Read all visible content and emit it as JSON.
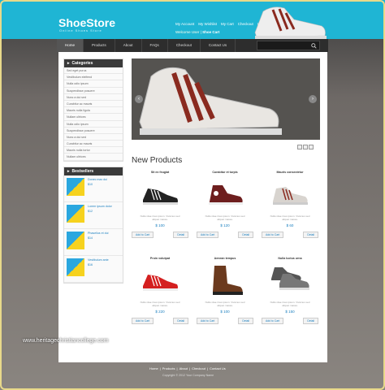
{
  "header": {
    "logo": "ShoeStore",
    "tagline": "Online Shoes Store",
    "links": [
      "My Account",
      "My Wishlist",
      "My Cart",
      "Checkout",
      "Log In"
    ],
    "welcome": "Welcome User",
    "cart": "Shoe Cart"
  },
  "nav": {
    "items": [
      "Home",
      "Products",
      "About",
      "FAQs",
      "Checkout",
      "Contact Us"
    ],
    "active": "Home"
  },
  "search": {
    "placeholder": ""
  },
  "sidebar": {
    "categories_title": "Categories",
    "categories": [
      "Sed eget purus",
      "Vestibulum eleifend",
      "Nulla odio ipsum",
      "Suspendisse posuere",
      "Nunc a dui sed",
      "Curabitur ac mauris",
      "Mauris nulla ligula",
      "Nullam ultrices",
      "Nulla odio ipsum",
      "Suspendisse posuere",
      "Nunc a dui sed",
      "Curabitur ac mauris",
      "Mauris nulla tortor",
      "Nullam ultrices"
    ],
    "bestsellers_title": "Bestsellers",
    "bestsellers": [
      {
        "name": "Donec max dui",
        "price": "$10"
      },
      {
        "name": "Lorem ipsum dolor",
        "price": "$12"
      },
      {
        "name": "Phasellus et dui",
        "price": "$14"
      },
      {
        "name": "Vestibulum ante",
        "price": "$16"
      }
    ]
  },
  "main": {
    "section_title": "New Products",
    "products": [
      {
        "name": "Sit ex feugiat",
        "price": "$ 100",
        "color": "black"
      },
      {
        "name": "Curabitur et turpis",
        "price": "$ 120",
        "color": "maroon"
      },
      {
        "name": "Mauris consectetur",
        "price": "$ 60",
        "color": "grey"
      },
      {
        "name": "Proin volutpat",
        "price": "$ 220",
        "color": "red"
      },
      {
        "name": "Aenean tempus",
        "price": "$ 100",
        "color": "brown"
      },
      {
        "name": "Nulla luctus urna",
        "price": "$ 150",
        "color": "darkgrey"
      }
    ],
    "add_label": "Add to Cart",
    "detail_label": "Detail",
    "desc": "Nulla vitae risus ipsum. Vivamus sed aliquet massa."
  },
  "footer": {
    "links": [
      "Home",
      "Products",
      "About",
      "Checkout",
      "Contact Us"
    ],
    "copyright": "Copyright © 2012 Your Company Name"
  },
  "watermark": "www.heritagechristiancollege.com",
  "colors": {
    "accent": "#1fb5d4",
    "link": "#1a7fbf",
    "nav": "#2d2d2d"
  }
}
